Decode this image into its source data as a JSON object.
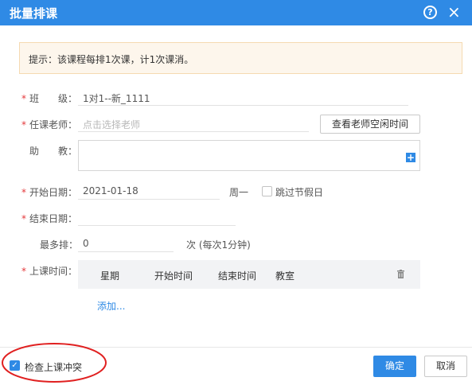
{
  "dialog": {
    "title": "批量排课",
    "help_icon": "?",
    "close_icon": "×"
  },
  "notice": {
    "text": "提示：该课程每排1次课，计1次课消。"
  },
  "form": {
    "class": {
      "label": "班　　级：",
      "value": "1对1--新_1111"
    },
    "teacher": {
      "label": "任课老师：",
      "placeholder": "点击选择老师",
      "button": "查看老师空闲时间"
    },
    "assistant": {
      "label": "助　　教："
    },
    "start_date": {
      "label": "开始日期：",
      "value": "2021-01-18",
      "weekday": "周一"
    },
    "skip_holidays": {
      "label": "跳过节假日",
      "checked": false
    },
    "end_date": {
      "label": "结束日期：",
      "value": ""
    },
    "max_sessions": {
      "label": "最多排：",
      "value": "0",
      "unit": "次 (每次1分钟)"
    },
    "schedule": {
      "label": "上课时间：",
      "columns": [
        "星期",
        "开始时间",
        "结束时间",
        "教室"
      ],
      "add_link": "添加..."
    }
  },
  "footer": {
    "check_conflict": {
      "label": "检查上课冲突",
      "checked": true
    },
    "confirm": "确定",
    "cancel": "取消"
  },
  "colors": {
    "primary": "#2f8ae5",
    "required_star": "#e4393c",
    "annotation_red": "#e02020"
  }
}
